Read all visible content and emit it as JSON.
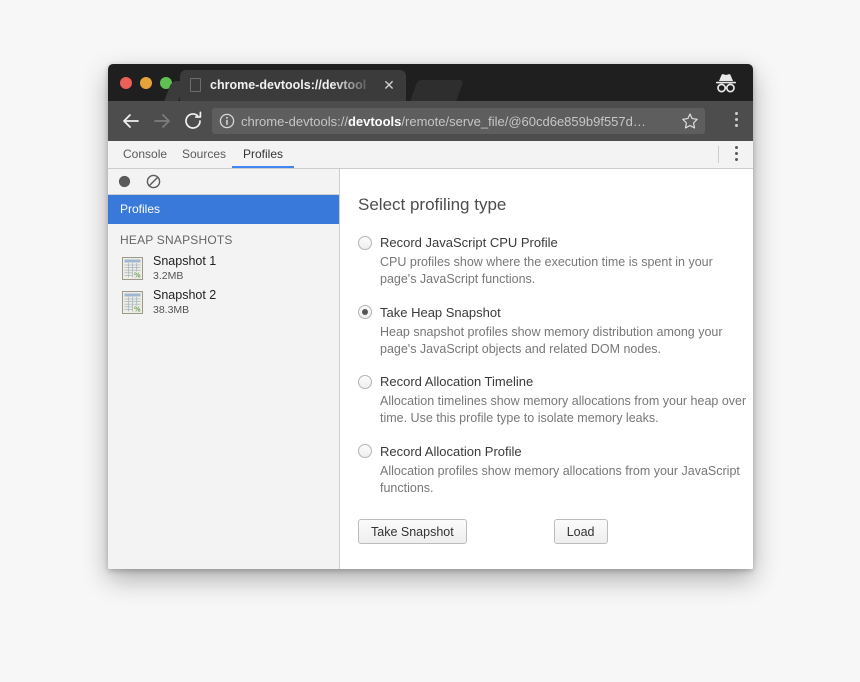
{
  "browser": {
    "tab": {
      "title": "chrome-devtools://devtools/",
      "favicon_icon": "page-icon",
      "close_icon": "close-icon"
    },
    "incognito_icon": "incognito-icon",
    "nav": {
      "back_icon": "back-arrow-icon",
      "forward_icon": "forward-arrow-icon",
      "reload_icon": "reload-icon"
    },
    "omnibox": {
      "site_info_icon": "info-circle-icon",
      "url_prefix": "chrome-devtools://",
      "url_highlight": "devtools",
      "url_suffix": "/remote/serve_file/@60cd6e859b9f557d…",
      "bookmark_icon": "star-icon",
      "menu_icon": "kebab-menu-icon"
    }
  },
  "devtools": {
    "tabs": [
      {
        "label": "Console",
        "active": false
      },
      {
        "label": "Sources",
        "active": false
      },
      {
        "label": "Profiles",
        "active": true
      }
    ],
    "menu_icon": "kebab-menu-icon",
    "sidebar": {
      "toolbar": {
        "record_icon": "record-circle-icon",
        "clear_icon": "clear-no-entry-icon"
      },
      "profiles_header": "Profiles",
      "section_label": "HEAP SNAPSHOTS",
      "snapshots": [
        {
          "name": "Snapshot 1",
          "size": "3.2MB",
          "icon": "heap-snapshot-icon"
        },
        {
          "name": "Snapshot 2",
          "size": "38.3MB",
          "icon": "heap-snapshot-icon"
        }
      ]
    },
    "main": {
      "title": "Select profiling type",
      "options": [
        {
          "label": "Record JavaScript CPU Profile",
          "description": "CPU profiles show where the execution time is spent in your page's JavaScript functions.",
          "selected": false
        },
        {
          "label": "Take Heap Snapshot",
          "description": "Heap snapshot profiles show memory distribution among your page's JavaScript objects and related DOM nodes.",
          "selected": true
        },
        {
          "label": "Record Allocation Timeline",
          "description": "Allocation timelines show memory allocations from your heap over time. Use this profile type to isolate memory leaks.",
          "selected": false
        },
        {
          "label": "Record Allocation Profile",
          "description": "Allocation profiles show memory allocations from your JavaScript functions.",
          "selected": false
        }
      ],
      "buttons": {
        "take_snapshot": "Take Snapshot",
        "load": "Load"
      }
    }
  },
  "colors": {
    "accent_blue": "#3879d9",
    "tab_active_underline": "#4285f4",
    "titlebar": "#1f1f1f",
    "toolbar": "#4d4d4d"
  }
}
